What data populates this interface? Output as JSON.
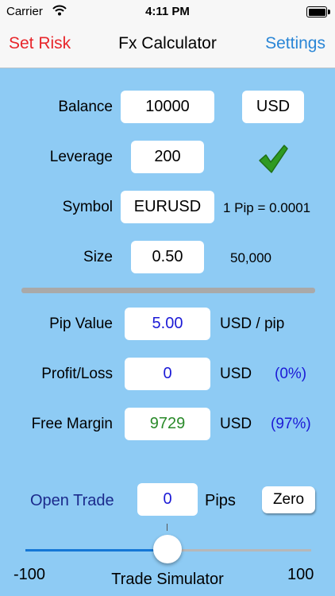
{
  "status_bar": {
    "carrier": "Carrier",
    "time": "4:11 PM"
  },
  "nav": {
    "left": "Set Risk",
    "title": "Fx Calculator",
    "right": "Settings"
  },
  "balance": {
    "label": "Balance",
    "value": "10000",
    "currency": "USD"
  },
  "leverage": {
    "label": "Leverage",
    "value": "200"
  },
  "symbol": {
    "label": "Symbol",
    "value": "EURUSD",
    "pip_info": "1 Pip = 0.0001"
  },
  "size": {
    "label": "Size",
    "value": "0.50",
    "units": "50,000"
  },
  "pip_value": {
    "label": "Pip Value",
    "value": "5.00",
    "unit": "USD / pip"
  },
  "profit_loss": {
    "label": "Profit/Loss",
    "value": "0",
    "unit": "USD",
    "percent": "(0%)"
  },
  "free_margin": {
    "label": "Free Margin",
    "value": "9729",
    "unit": "USD",
    "percent": "(97%)"
  },
  "trade": {
    "label": "Open Trade",
    "value": "0",
    "unit": "Pips",
    "zero_button": "Zero"
  },
  "simulator": {
    "min": "-100",
    "max": "100",
    "label": "Trade Simulator",
    "position": 0.5
  },
  "colors": {
    "accent_red": "#e8262b",
    "accent_blue": "#2a86d6",
    "value_blue": "#1c1ad6",
    "value_green": "#2a8a2a",
    "background": "#8ecbf4"
  },
  "icons": {
    "check": "checkmark-icon",
    "wifi": "wifi-icon",
    "battery": "battery-icon"
  }
}
